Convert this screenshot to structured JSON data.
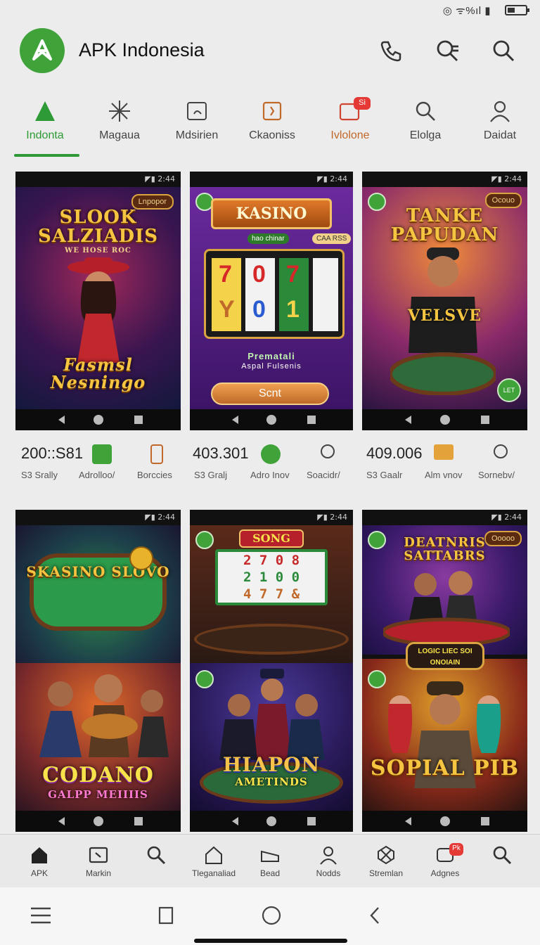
{
  "status_bar": {
    "text": "◎ ᯤ%ıl ▮"
  },
  "header": {
    "app_title": "APK Indonesia",
    "icons": [
      "phone-icon",
      "search-filter-icon",
      "search-icon"
    ]
  },
  "categories": [
    {
      "label": "Indonta",
      "icon": "triangle-icon",
      "active": true
    },
    {
      "label": "Magaua",
      "icon": "sparkle-icon",
      "active": false
    },
    {
      "label": "Mdsirien",
      "icon": "tablet-icon",
      "active": false
    },
    {
      "label": "Ckaoniss",
      "icon": "square-icon",
      "active": false
    },
    {
      "label": "Ivlolone",
      "icon": "chat-icon",
      "active": false,
      "badge": "Si"
    },
    {
      "label": "Elolga",
      "icon": "search-icon",
      "active": false
    },
    {
      "label": "Daidat",
      "icon": "person-icon",
      "active": false
    }
  ],
  "cards": [
    {
      "status": "◤▮ 2:44",
      "chip": "Lnpopor",
      "title_top": "SLOOK SALZIADIS",
      "subtitle": "WE HOSE ROC",
      "title_bottom": "Fasmsl Nesningo"
    },
    {
      "status": "◤▮ 2:44",
      "banner": "KASINO",
      "sub_left": "hao chinar",
      "sub_right": "CAA RSS",
      "reels": [
        "7",
        "0",
        "7",
        "Y",
        "0",
        "1"
      ],
      "caption1": "Prematali",
      "caption2": "Aspal Fulsenis",
      "button": "Scnt"
    },
    {
      "status": "◤▮ 2:44",
      "chip": "Ocouo",
      "title_top": "TANKE PAPUDAN",
      "shirt": "VELSVE",
      "mark": "LET"
    },
    {
      "status": "◤▮ 2:44",
      "title_top": "SKASINO SLOVO"
    },
    {
      "status": "◤▮ 2:44",
      "sign": "SONG",
      "reel_rows": [
        "2 7 0 8",
        "2 1 0 0",
        "4 7 7 &"
      ]
    },
    {
      "status": "◤▮ 2:44",
      "chip": "Ooooo",
      "title_top": "DEATNRIS SATTABRS"
    },
    {
      "status": "",
      "title_bottom": "CODANO",
      "subtitle": "GALPP MEIIIIS"
    },
    {
      "status": "",
      "title_bottom": "HIAPON",
      "subtitle": "AMETINDS"
    },
    {
      "status": "",
      "sign": "LOGIC LIEC SOI ONOIAIN",
      "title_bottom": "SOPIAL PIB"
    }
  ],
  "stats": [
    {
      "value": "200::S81",
      "sub1": "S3 Srally",
      "sub2": "Adrolloo/",
      "sub3": "Borccies",
      "icon1": "chart-icon",
      "icon2": "lock-icon"
    },
    {
      "value": "403.301",
      "sub1": "S3 Gralj",
      "sub2": "Adro Inov",
      "sub3": "Soacidr/",
      "icon1": "refresh-icon",
      "icon2": "person-icon"
    },
    {
      "value": "409.006",
      "sub1": "S3 Gaalr",
      "sub2": "Alm vnov",
      "sub3": "Sornebv/",
      "icon1": "list-icon",
      "icon2": "person-icon"
    }
  ],
  "bottom_nav": [
    {
      "label": "APK",
      "icon": "home-icon"
    },
    {
      "label": "Markin",
      "icon": "tablet-icon"
    },
    {
      "label": "",
      "icon": "search-icon"
    },
    {
      "label": "Tleganaliad",
      "icon": "house-icon"
    },
    {
      "label": "Bead",
      "icon": "bed-icon"
    },
    {
      "label": "Nodds",
      "icon": "person-icon"
    },
    {
      "label": "Stremlan",
      "icon": "badge-icon"
    },
    {
      "label": "Adgnes",
      "icon": "chat-icon",
      "badge": "Pk"
    },
    {
      "label": "",
      "icon": "search-icon"
    }
  ],
  "colors": {
    "accent": "#2e9a35",
    "badge": "#e53935",
    "gold": "#f5c542"
  }
}
